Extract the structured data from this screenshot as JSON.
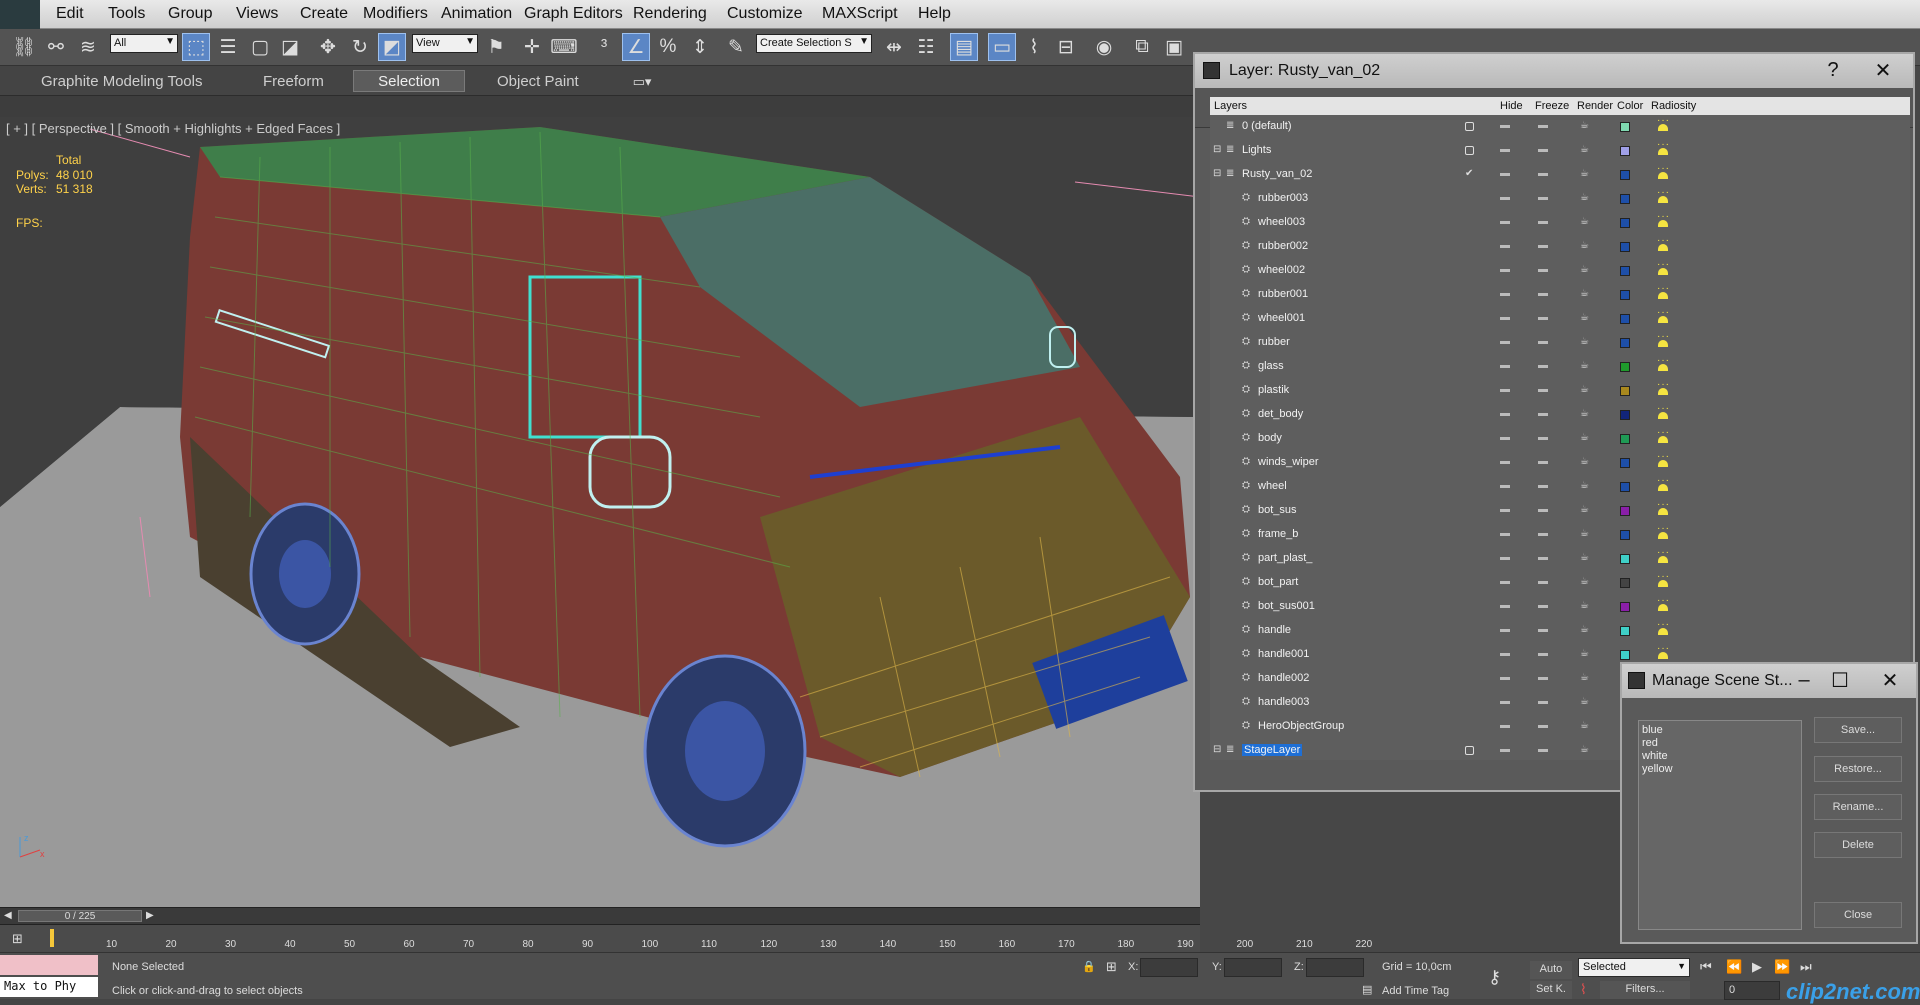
{
  "menu": [
    "Edit",
    "Tools",
    "Group",
    "Views",
    "Create",
    "Modifiers",
    "Animation",
    "Graph Editors",
    "Rendering",
    "Customize",
    "MAXScript",
    "Help"
  ],
  "toolbar": {
    "selection_filter": "All",
    "reference_coord": "View",
    "named_selection": "Create Selection S"
  },
  "ribbon": {
    "tabs": [
      "Graphite Modeling Tools",
      "Freeform",
      "Selection",
      "Object Paint"
    ],
    "active_index": 2
  },
  "viewport": {
    "label": "[ + ] [ Perspective ] [ Smooth + Highlights + Edged Faces ]",
    "stats": {
      "total_label": "Total",
      "polys_label": "Polys:",
      "polys_value": "48 010",
      "verts_label": "Verts:",
      "verts_value": "51 318",
      "fps_label": "FPS:"
    }
  },
  "layer_dialog": {
    "title": "Layer: Rusty_van_02",
    "columns": [
      "Layers",
      "Hide",
      "Freeze",
      "Render",
      "Color",
      "Radiosity"
    ],
    "rows": [
      {
        "name": "0 (default)",
        "indent": 0,
        "color": "#7fd8b0",
        "tick": "box"
      },
      {
        "name": "Lights",
        "indent": 0,
        "color": "#a0a0e8",
        "tick": "box",
        "expand": true
      },
      {
        "name": "Rusty_van_02",
        "indent": 0,
        "color": "#1e4fa8",
        "tick": "check",
        "expand": true
      },
      {
        "name": "rubber003",
        "indent": 1,
        "color": "#1e4fa8"
      },
      {
        "name": "wheel003",
        "indent": 1,
        "color": "#1e4fa8"
      },
      {
        "name": "rubber002",
        "indent": 1,
        "color": "#1e4fa8"
      },
      {
        "name": "wheel002",
        "indent": 1,
        "color": "#1e4fa8"
      },
      {
        "name": "rubber001",
        "indent": 1,
        "color": "#1e4fa8"
      },
      {
        "name": "wheel001",
        "indent": 1,
        "color": "#1e4fa8"
      },
      {
        "name": "rubber",
        "indent": 1,
        "color": "#1e4fa8"
      },
      {
        "name": "glass",
        "indent": 1,
        "color": "#1f9a2c"
      },
      {
        "name": "plastik",
        "indent": 1,
        "color": "#a8881e"
      },
      {
        "name": "det_body",
        "indent": 1,
        "color": "#12257a"
      },
      {
        "name": "body",
        "indent": 1,
        "color": "#1f9a55"
      },
      {
        "name": "winds_wiper",
        "indent": 1,
        "color": "#1e4fa8"
      },
      {
        "name": "wheel",
        "indent": 1,
        "color": "#1e4fa8"
      },
      {
        "name": "bot_sus",
        "indent": 1,
        "color": "#8a1fa8"
      },
      {
        "name": "frame_b",
        "indent": 1,
        "color": "#1e4fa8"
      },
      {
        "name": "part_plast_",
        "indent": 1,
        "color": "#3fd0c8"
      },
      {
        "name": "bot_part",
        "indent": 1,
        "color": "#444444"
      },
      {
        "name": "bot_sus001",
        "indent": 1,
        "color": "#8a1fa8"
      },
      {
        "name": "handle",
        "indent": 1,
        "color": "#3fd0c8"
      },
      {
        "name": "handle001",
        "indent": 1,
        "color": "#3fd0c8"
      },
      {
        "name": "handle002",
        "indent": 1,
        "color": "#3fd0c8"
      },
      {
        "name": "handle003",
        "indent": 1,
        "color": "#3fd0c8"
      },
      {
        "name": "HeroObjectGroup",
        "indent": 1,
        "color": "#3fd0c8"
      },
      {
        "name": "StageLayer",
        "indent": 0,
        "color": "#3fd0c8",
        "tick": "box",
        "selected": true,
        "expand": true
      }
    ]
  },
  "scene_states": {
    "title": "Manage Scene St...",
    "states": [
      "blue",
      "red",
      "white",
      "yellow"
    ],
    "buttons": [
      "Save...",
      "Restore...",
      "Rename...",
      "Delete",
      "Close"
    ]
  },
  "timeline": {
    "frame": "0 / 225",
    "ticks": [
      "10",
      "20",
      "30",
      "40",
      "50",
      "60",
      "70",
      "80",
      "90",
      "100",
      "110",
      "120",
      "130",
      "140",
      "150",
      "160",
      "170",
      "180",
      "190",
      "200",
      "210",
      "220"
    ]
  },
  "status": {
    "script_listener": "Max to Phy",
    "selection": "None Selected",
    "prompt": "Click or click-and-drag to select objects",
    "x_label": "X:",
    "y_label": "Y:",
    "z_label": "Z:",
    "grid": "Grid = 10,0cm",
    "add_time_tag": "Add Time Tag",
    "auto_label": "Auto",
    "set_key_label": "Set K.",
    "key_filter": "Selected",
    "filters_label": "Filters...",
    "frame_field": "0"
  },
  "watermark": "clip2net.com",
  "colors": {
    "accent": "#1e6fd6",
    "stat_text": "#ffd24a",
    "panel": "#5e5e5e"
  }
}
